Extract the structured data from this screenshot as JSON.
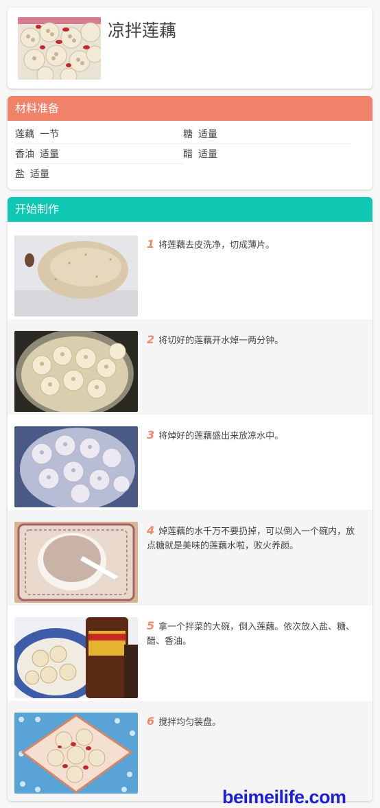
{
  "colors": {
    "ingredients_header": "#f0826a",
    "steps_header": "#0ec8b4",
    "step_number": "#ee8a6a",
    "watermark": "#1a1fd8"
  },
  "recipe": {
    "title": "凉拌莲藕",
    "image": "lotus-root-salad-photo"
  },
  "ingredients": {
    "header": "材料准备",
    "items": [
      {
        "name": "莲藕",
        "amount": "一节"
      },
      {
        "name": "糖",
        "amount": "适量"
      },
      {
        "name": "香油",
        "amount": "适量"
      },
      {
        "name": "醋",
        "amount": "适量"
      },
      {
        "name": "盐",
        "amount": "适量"
      }
    ]
  },
  "steps": {
    "header": "开始制作",
    "items": [
      {
        "num": "1",
        "text": "将莲藕去皮洗净，切成薄片。",
        "image": "whole-lotus-root-photo"
      },
      {
        "num": "2",
        "text": "将切好的莲藕开水焯一两分钟。",
        "image": "lotus-slices-in-pot-photo"
      },
      {
        "num": "3",
        "text": "将焯好的莲藕盛出来放凉水中。",
        "image": "lotus-slices-in-water-photo"
      },
      {
        "num": "4",
        "text": "焯莲藕的水千万不要扔掉，可以倒入一个碗内，放点糖就是美味的莲藕水啦，败火养颜。",
        "image": "lotus-water-bowl-photo"
      },
      {
        "num": "5",
        "text": "拿一个拌菜的大碗，倒入莲藕。依次放入盐、糖、醋、香油。",
        "image": "seasoning-lotus-photo"
      },
      {
        "num": "6",
        "text": "搅拌均匀装盘。",
        "image": "plated-lotus-salad-photo"
      }
    ]
  },
  "watermark": "beimeilife.com"
}
